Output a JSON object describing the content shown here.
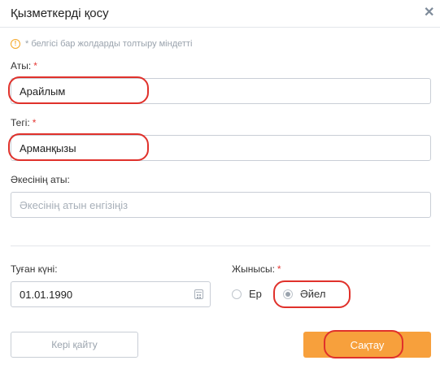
{
  "dialog": {
    "title": "Қызметкерді қосу",
    "close": "✕",
    "note": "* белгісі бар жолдарды толтыру міндетті",
    "note_icon": "info-icon"
  },
  "fields": {
    "first_name": {
      "label": "Аты:",
      "value": "Арайлым"
    },
    "last_name": {
      "label": "Тегі:",
      "value": "Арманқызы"
    },
    "patronymic": {
      "label": "Әкесінің аты:",
      "placeholder": "Әкесінің атын енгізіңіз"
    },
    "birth_date": {
      "label": "Туған күні:",
      "value": "01.01.1990",
      "icon": "calendar-icon"
    },
    "gender": {
      "label": "Жынысы:",
      "options": [
        {
          "label": "Ер",
          "checked": false
        },
        {
          "label": "Әйел",
          "checked": true
        }
      ]
    }
  },
  "required_mark": "*",
  "buttons": {
    "back": "Кері қайту",
    "save": "Сақтау"
  },
  "colors": {
    "accent": "#f7a03c",
    "required": "#e53935",
    "highlight": "#e0312b",
    "info": "#f5a623"
  }
}
